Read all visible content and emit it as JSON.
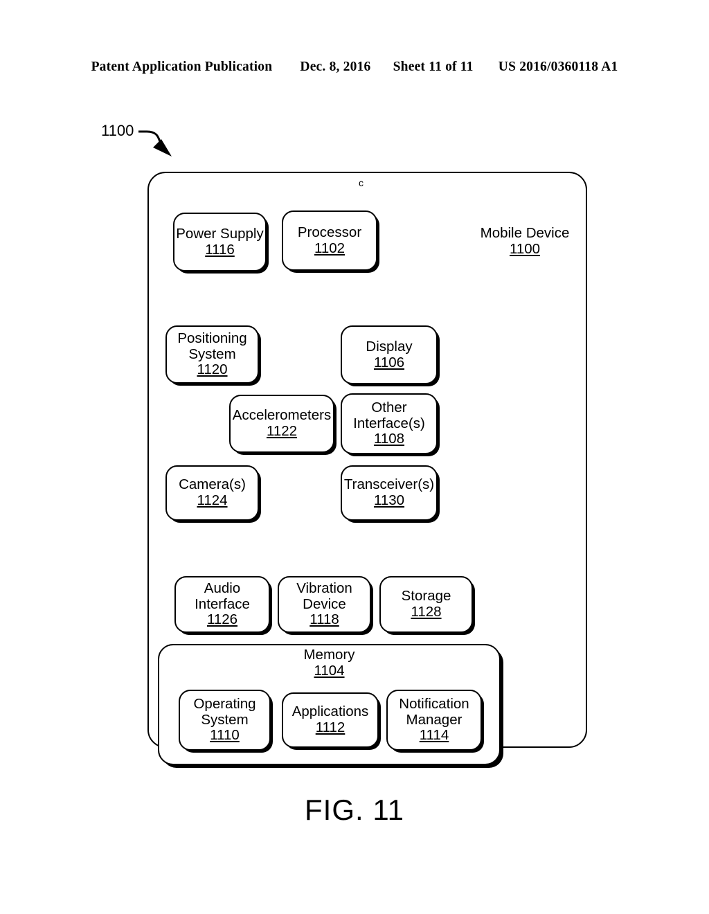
{
  "header": {
    "publication": "Patent Application Publication",
    "date": "Dec. 8, 2016",
    "sheet": "Sheet 11 of 11",
    "patent_number": "US 2016/0360118 A1"
  },
  "figure": {
    "caption": "FIG. 11",
    "lead_label": "1100",
    "stray_mark": "c",
    "outer_device": {
      "name": "Mobile Device",
      "ref": "1100"
    },
    "memory_container": {
      "name": "Memory",
      "ref": "1104"
    },
    "nodes": [
      {
        "id": "power-supply",
        "name": "Power Supply",
        "ref": "1116"
      },
      {
        "id": "processor",
        "name": "Processor",
        "ref": "1102"
      },
      {
        "id": "positioning-system",
        "name": "Positioning\nSystem",
        "ref": "1120"
      },
      {
        "id": "display",
        "name": "Display",
        "ref": "1106"
      },
      {
        "id": "accelerometers",
        "name": "Accelerometers",
        "ref": "1122"
      },
      {
        "id": "other-interfaces",
        "name": "Other\nInterface(s)",
        "ref": "1108"
      },
      {
        "id": "cameras",
        "name": "Camera(s)",
        "ref": "1124"
      },
      {
        "id": "transceivers",
        "name": "Transceiver(s)",
        "ref": "1130"
      },
      {
        "id": "audio-interface",
        "name": "Audio Interface",
        "ref": "1126"
      },
      {
        "id": "vibration-device",
        "name": "Vibration\nDevice",
        "ref": "1118"
      },
      {
        "id": "storage",
        "name": "Storage",
        "ref": "1128"
      },
      {
        "id": "operating-system",
        "name": "Operating\nSystem",
        "ref": "1110"
      },
      {
        "id": "applications",
        "name": "Applications",
        "ref": "1112"
      },
      {
        "id": "notification-manager",
        "name": "Notification\nManager",
        "ref": "1114"
      }
    ],
    "colors": {
      "line": "#000000",
      "background": "#ffffff"
    }
  }
}
